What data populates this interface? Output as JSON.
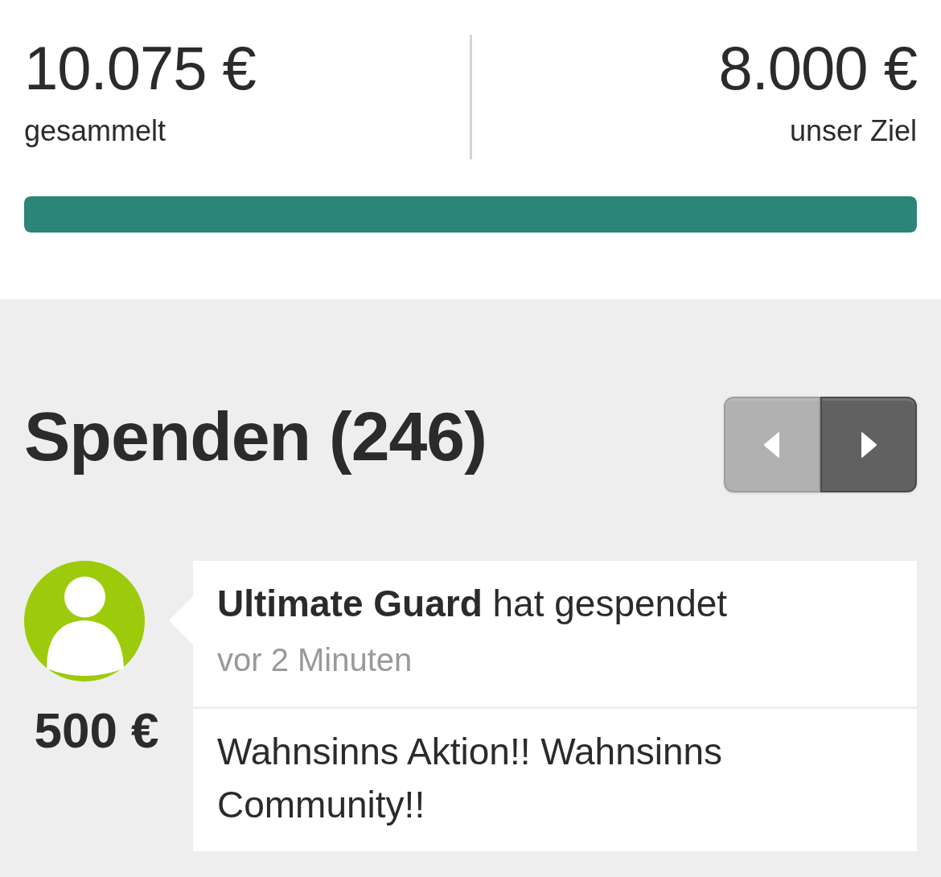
{
  "summary": {
    "raised": {
      "amount": "10.075 €",
      "label": "gesammelt"
    },
    "goal": {
      "amount": "8.000 €",
      "label": "unser Ziel"
    },
    "progress": {
      "level": 1
    }
  },
  "donations_section": {
    "title": "Spenden (246)",
    "pager": [
      {
        "kind": "prev",
        "disabled": true
      },
      {
        "kind": "next",
        "disabled": false
      }
    ],
    "donations": [
      {
        "donor_line": "**Ultimate Guard** hat gespendet",
        "time": "vor 2 Minuten",
        "amount": "500 €",
        "message": "Wahnsinns Aktion!! Wahnsinns Community!!"
      }
    ]
  }
}
